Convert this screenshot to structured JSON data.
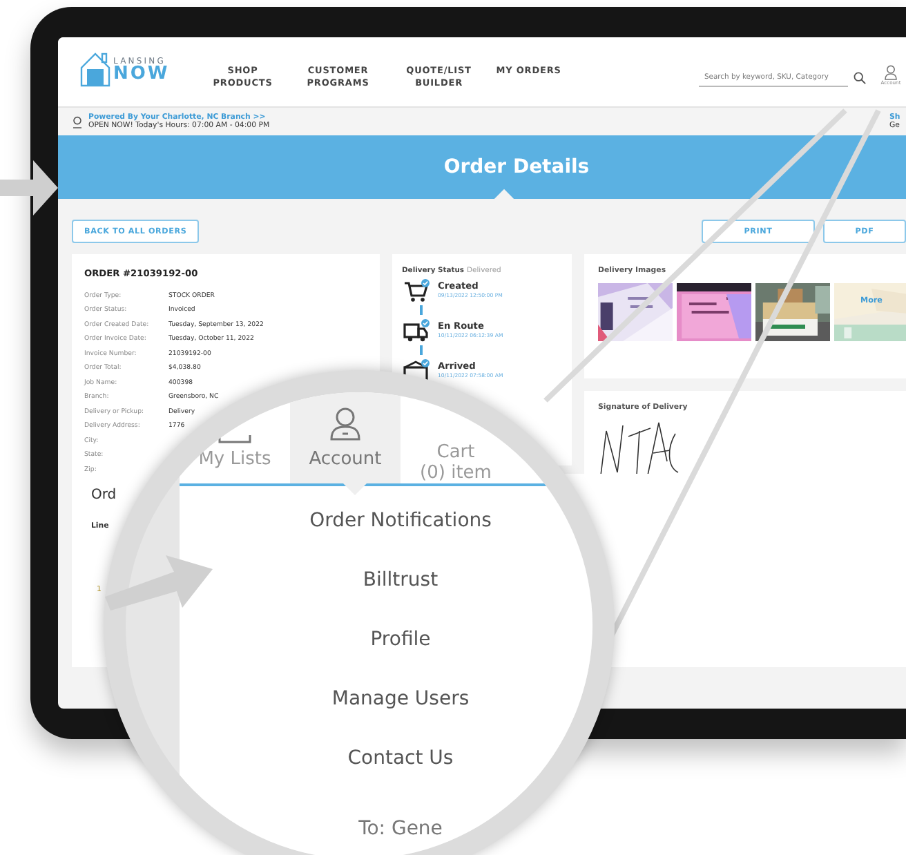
{
  "header": {
    "logo_top": "LANSING",
    "logo_bottom": "NOW",
    "nav": [
      "SHOP PRODUCTS",
      "CUSTOMER PROGRAMS",
      "QUOTE/LIST BUILDER",
      "MY ORDERS"
    ],
    "search": {
      "placeholder": "Search by keyword, SKU, Category"
    },
    "account_label": "Account"
  },
  "branch_bar": {
    "link": "Powered By Your Charlotte, NC Branch >>",
    "hours": "OPEN NOW! Today's Hours: 07:00 AM - 04:00 PM",
    "right_lines": [
      "Sh",
      "Ge"
    ]
  },
  "banner": {
    "title": "Order Details"
  },
  "actions": {
    "back": "BACK TO ALL ORDERS",
    "buttons": [
      "PRINT",
      "PDF"
    ]
  },
  "order": {
    "title": "ORDER #21039192-00",
    "fields": [
      {
        "label": "Order Type:",
        "value": "STOCK ORDER"
      },
      {
        "label": "Order Status:",
        "value": "Invoiced"
      },
      {
        "label": "Order Created Date:",
        "value": "Tuesday, September 13, 2022"
      },
      {
        "label": "Order Invoice Date:",
        "value": "Tuesday, October 11, 2022"
      },
      {
        "label": "Invoice Number:",
        "value": "21039192-00"
      },
      {
        "label": "Order Total:",
        "value": "$4,038.80"
      },
      {
        "label": "Job Name:",
        "value": "400398"
      },
      {
        "label": "Branch:",
        "value": "Greensboro, NC"
      },
      {
        "label": "Delivery or Pickup:",
        "value": "Delivery"
      },
      {
        "label": "Delivery Address:",
        "value": "1776"
      },
      {
        "label": "City:"
      },
      {
        "label": "State:"
      },
      {
        "label": "Zip:"
      }
    ]
  },
  "delivery_status": {
    "label": "Delivery Status",
    "value": "Delivered",
    "steps": [
      {
        "kind": "cart",
        "title": "Created",
        "time": "09/13/2022 12:50:00 PM",
        "done": true
      },
      {
        "kind": "truck",
        "title": "En Route",
        "time": "10/11/2022 06:12:39 AM",
        "done": true
      },
      {
        "kind": "box",
        "title": "Arrived",
        "time": "10/11/2022 07:58:00 AM",
        "done": true
      }
    ]
  },
  "delivery_images": {
    "title": "Delivery Images",
    "more": "More"
  },
  "signature": {
    "title": "Signature of Delivery"
  },
  "order_lines": {
    "title": "Ord",
    "column_1": "Line",
    "rows": [
      "1"
    ]
  },
  "magnifier": {
    "tabs": [
      {
        "kind": "list",
        "label": "My Lists",
        "selected": false
      },
      {
        "kind": "account",
        "label": "Account",
        "selected": true
      },
      {
        "kind": "cart",
        "label": "Cart",
        "sub": "(0) item",
        "selected": false
      }
    ],
    "menu": [
      "Order Notifications",
      "Billtrust",
      "Profile",
      "Manage Users",
      "Contact Us"
    ],
    "footer": "To: Gene"
  }
}
